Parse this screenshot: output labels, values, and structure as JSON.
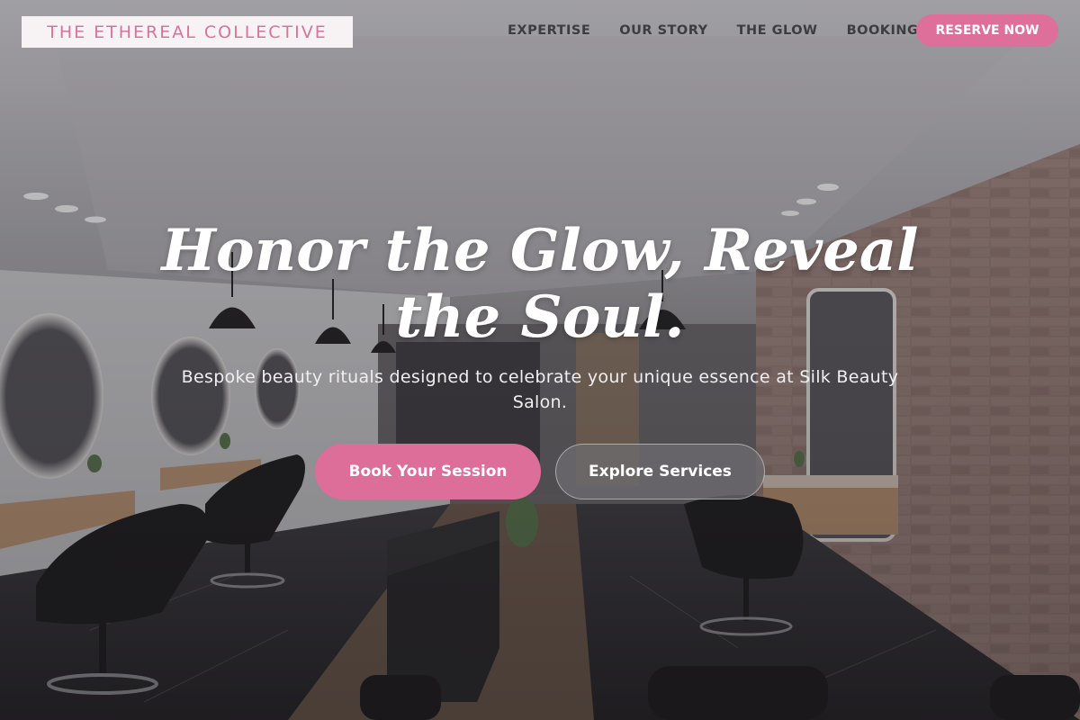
{
  "brand": {
    "logo_text": "THE ETHEREAL COLLECTIVE"
  },
  "nav": {
    "items": [
      {
        "label": "EXPERTISE"
      },
      {
        "label": "OUR STORY"
      },
      {
        "label": "THE GLOW"
      },
      {
        "label": "BOOKING"
      }
    ],
    "cta_label": "RESERVE NOW"
  },
  "hero": {
    "headline": "Honor the Glow, Reveal the Soul.",
    "subheadline": "Bespoke beauty rituals designed to celebrate your unique essence at Silk Beauty Salon.",
    "primary_button": "Book Your Session",
    "secondary_button": "Explore Services"
  },
  "colors": {
    "accent_pink": "#dd6f9a",
    "logo_bg": "#f7f2f3",
    "nav_text": "#3d3d3f"
  }
}
